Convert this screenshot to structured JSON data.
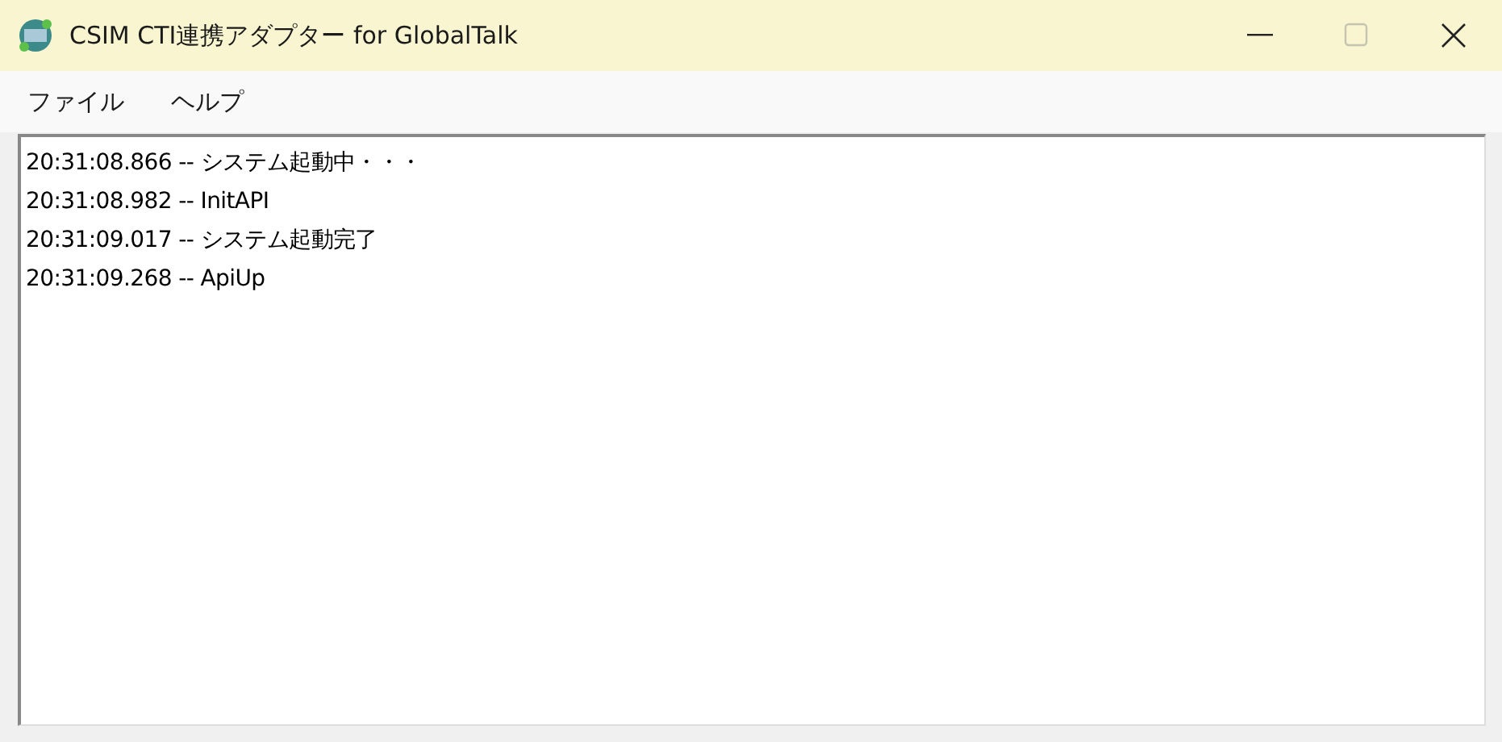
{
  "window": {
    "title": "CSIM CTI連携アダプター for GlobalTalk",
    "maximize_disabled": true
  },
  "menu": [
    {
      "label": "ファイル"
    },
    {
      "label": "ヘルプ"
    }
  ],
  "log": [
    "20:31:08.866 -- システム起動中・・・",
    "20:31:08.982 -- InitAPI",
    "20:31:09.017 -- システム起動完了",
    "20:31:09.268 -- ApiUp"
  ]
}
